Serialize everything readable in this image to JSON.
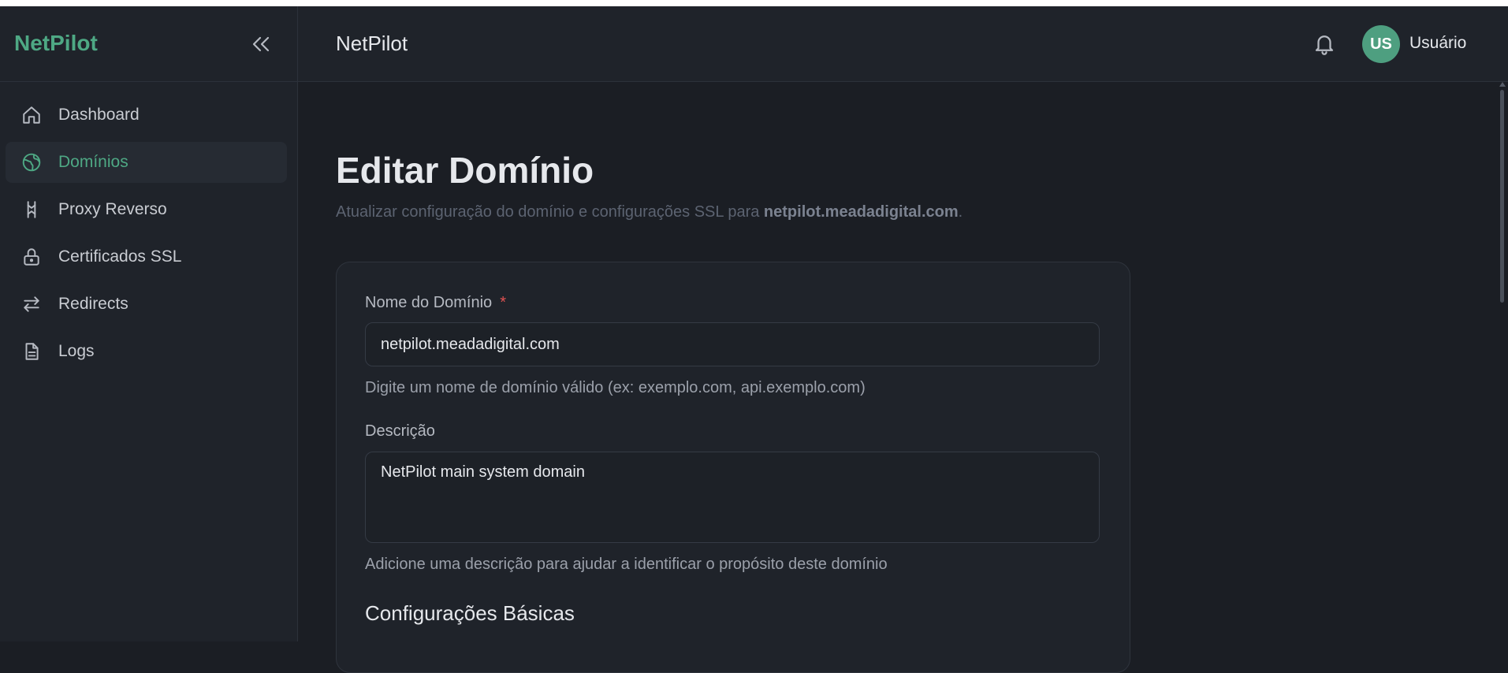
{
  "sidebar": {
    "brand": "NetPilot",
    "items": [
      {
        "label": "Dashboard",
        "icon": "home-icon"
      },
      {
        "label": "Domínios",
        "icon": "globe-icon",
        "active": true
      },
      {
        "label": "Proxy Reverso",
        "icon": "proxy-icon"
      },
      {
        "label": "Certificados SSL",
        "icon": "lock-icon"
      },
      {
        "label": "Redirects",
        "icon": "arrows-icon"
      },
      {
        "label": "Logs",
        "icon": "file-text-icon"
      }
    ]
  },
  "header": {
    "title": "NetPilot",
    "avatar_initials": "US",
    "username": "Usuário"
  },
  "main": {
    "title": "Editar Domínio",
    "subtitle_prefix": "Atualizar configuração do domínio e configurações SSL para ",
    "subtitle_domain": "netpilot.meadadigital.com",
    "subtitle_suffix": "."
  },
  "form": {
    "domain_label": "Nome do Domínio",
    "required_mark": "*",
    "domain_value": "netpilot.meadadigital.com",
    "domain_help": "Digite um nome de domínio válido (ex: exemplo.com, api.exemplo.com)",
    "description_label": "Descrição",
    "description_value": "NetPilot main system domain",
    "description_help": "Adicione uma descrição para ajudar a identificar o propósito deste domínio",
    "section_basic": "Configurações Básicas"
  },
  "colors": {
    "accent": "#4ea884",
    "background": "#1b1e24",
    "panel": "#1f232a",
    "required": "#e05252"
  }
}
